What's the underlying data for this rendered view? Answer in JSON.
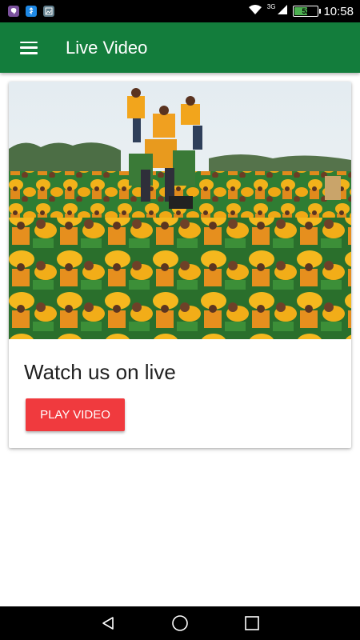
{
  "status_bar": {
    "time": "10:58",
    "battery_level": "52",
    "network_type": "3G",
    "notification_icons": [
      "viber-icon",
      "usb-icon",
      "image-icon"
    ]
  },
  "app_bar": {
    "title": "Live Video",
    "color": "#137d3c"
  },
  "card": {
    "title": "Watch us on live",
    "play_button_label": "PLAY VIDEO",
    "image_description": "crowd-human-pyramid-photo"
  },
  "nav_bar": {
    "buttons": [
      "back-icon",
      "home-icon",
      "recents-icon"
    ]
  },
  "colors": {
    "primary": "#137d3c",
    "accent": "#f03a3e",
    "crowd_yellow": "#f2b21a",
    "crowd_green": "#2e8b3a"
  }
}
